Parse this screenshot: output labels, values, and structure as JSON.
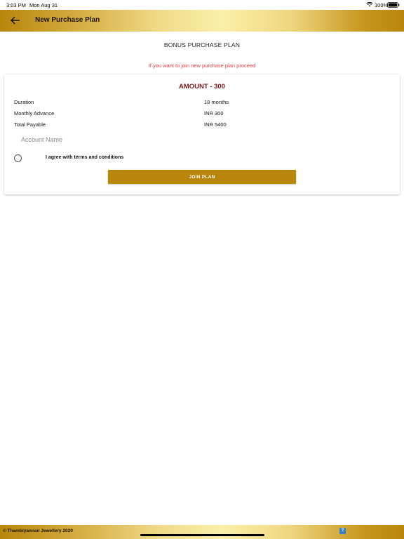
{
  "status_bar": {
    "time": "3:03 PM",
    "date": "Mon Aug 31",
    "battery": "100%",
    "icons": [
      "wifi-icon",
      "battery-icon"
    ]
  },
  "app_bar": {
    "title": "New Purchase Plan",
    "back_icon": "arrow-left-icon"
  },
  "page": {
    "heading": "BONUS PURCHASE PLAN",
    "info_message": "If you want to join new purchase plan proceed"
  },
  "plan_card": {
    "amount_title": "AMOUNT - 300",
    "rows": [
      {
        "label": "Duration",
        "value": "18 months"
      },
      {
        "label": "Monthly Advance",
        "value": "INR 300"
      },
      {
        "label": "Total Payable",
        "value": "INR 5400"
      }
    ],
    "account_name": {
      "value": "",
      "placeholder": "Account Name"
    },
    "terms": {
      "label": "I agree with terms and conditions",
      "checked": false
    },
    "join_button": "JOIN PLAN"
  },
  "footer": {
    "copyright": "© Thambiyannan Jewellery 2020",
    "help_icon_label": "?"
  },
  "colors": {
    "gold_primary": "#b8860b",
    "gold_light": "#fbf0a8",
    "amount_title": "#7a1a1a",
    "info_message": "#e3383b"
  }
}
